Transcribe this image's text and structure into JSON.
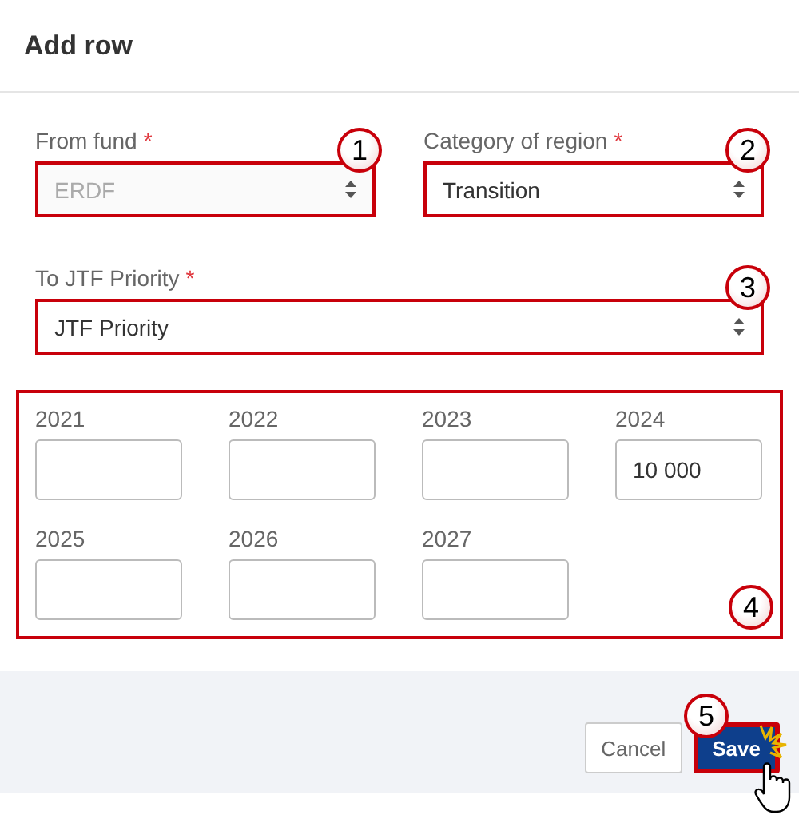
{
  "dialog": {
    "title": "Add row"
  },
  "selects": [
    {
      "label": "From fund",
      "required_mark": "*",
      "value": "ERDF",
      "disabled": true,
      "callout": "1"
    },
    {
      "label": "Category of region",
      "required_mark": "*",
      "value": "Transition",
      "disabled": false,
      "callout": "2"
    },
    {
      "label": "To JTF Priority",
      "required_mark": "*",
      "value": "JTF Priority",
      "disabled": false,
      "callout": "3"
    }
  ],
  "years": {
    "callout": "4",
    "fields": [
      {
        "label": "2021"
      },
      {
        "label": "2022"
      },
      {
        "label": "2023"
      },
      {
        "label": "2024",
        "value": "10 000"
      },
      {
        "label": "2025"
      },
      {
        "label": "2026"
      },
      {
        "label": "2027"
      }
    ]
  },
  "footer": {
    "buttons": [
      {
        "label": "Cancel",
        "kind": "secondary"
      },
      {
        "label": "Save",
        "kind": "primary",
        "callout": "5"
      }
    ]
  }
}
